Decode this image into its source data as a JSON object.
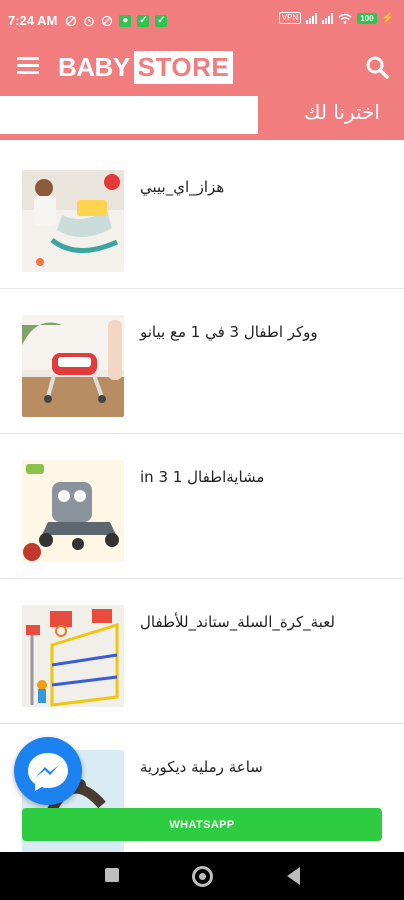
{
  "status": {
    "time": "7:24 AM",
    "vpn": "VPN",
    "battery": "100"
  },
  "header": {
    "logo_part1": "BABY",
    "logo_part2": "STORE"
  },
  "section": {
    "title": "اخترنا لك"
  },
  "products": [
    {
      "title": "هزاز_اي_بيبي"
    },
    {
      "title": "ووكر اطفال 3 في 1 مع بيانو"
    },
    {
      "title": "مشايةاطفال 1 in 3"
    },
    {
      "title": "لعبة_كرة_السلة_ستاند_للأطفال"
    },
    {
      "title": "ساعة رملية ديكورية"
    }
  ],
  "whatsapp_label": "WHATSAPP",
  "colors": {
    "brand": "#f17d7f",
    "whatsapp": "#2ecc40",
    "messenger": "#1b82f0"
  }
}
